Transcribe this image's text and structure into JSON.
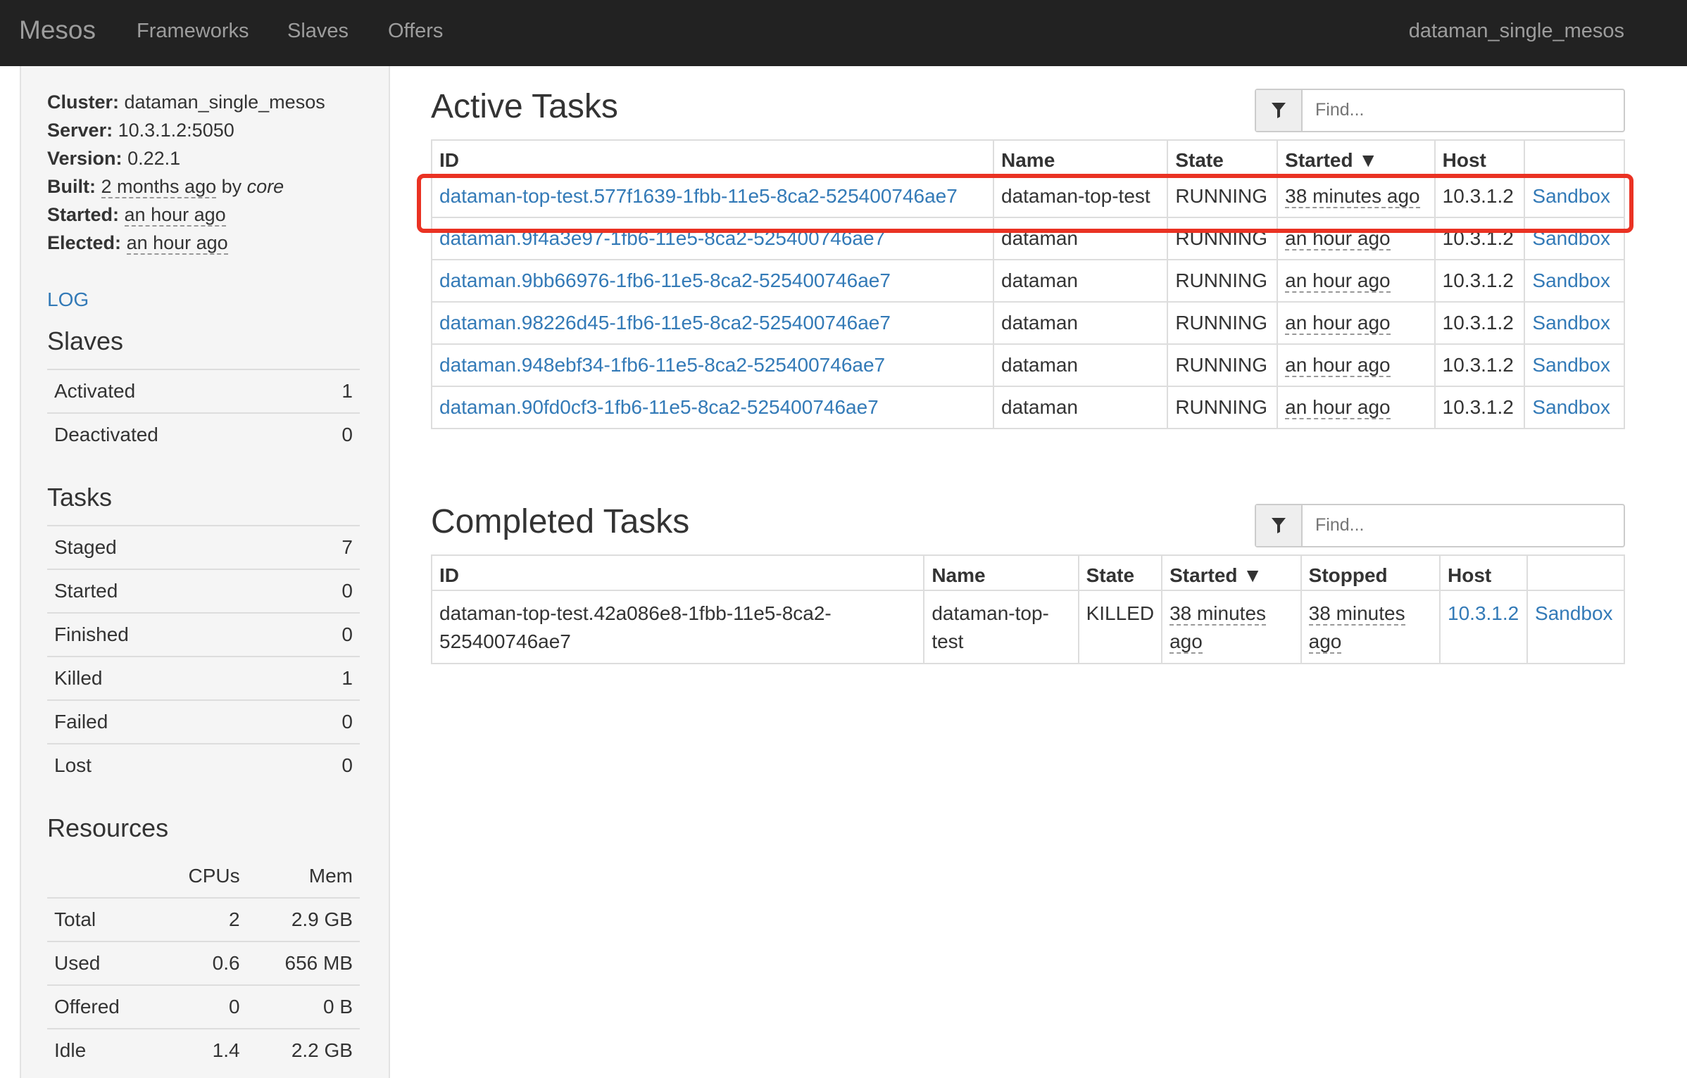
{
  "navbar": {
    "brand": "Mesos",
    "items": [
      "Frameworks",
      "Slaves",
      "Offers"
    ],
    "cluster": "dataman_single_mesos"
  },
  "sidebar": {
    "cluster_label": "Cluster:",
    "cluster_value": "dataman_single_mesos",
    "server_label": "Server:",
    "server_value": "10.3.1.2:5050",
    "version_label": "Version:",
    "version_value": "0.22.1",
    "built_label": "Built:",
    "built_time": "2 months ago",
    "built_by": "by",
    "built_user": "core",
    "started_label": "Started:",
    "started_value": "an hour ago",
    "elected_label": "Elected:",
    "elected_value": "an hour ago",
    "log_link": "LOG",
    "slaves_heading": "Slaves",
    "slaves": [
      {
        "label": "Activated",
        "value": "1"
      },
      {
        "label": "Deactivated",
        "value": "0"
      }
    ],
    "tasks_heading": "Tasks",
    "tasks": [
      {
        "label": "Staged",
        "value": "7"
      },
      {
        "label": "Started",
        "value": "0"
      },
      {
        "label": "Finished",
        "value": "0"
      },
      {
        "label": "Killed",
        "value": "1"
      },
      {
        "label": "Failed",
        "value": "0"
      },
      {
        "label": "Lost",
        "value": "0"
      }
    ],
    "resources_heading": "Resources",
    "resources_cols": [
      "CPUs",
      "Mem"
    ],
    "resources": [
      {
        "label": "Total",
        "cpus": "2",
        "mem": "2.9 GB"
      },
      {
        "label": "Used",
        "cpus": "0.6",
        "mem": "656 MB"
      },
      {
        "label": "Offered",
        "cpus": "0",
        "mem": "0 B"
      },
      {
        "label": "Idle",
        "cpus": "1.4",
        "mem": "2.2 GB"
      }
    ]
  },
  "active": {
    "title": "Active Tasks",
    "filter_placeholder": "Find...",
    "headers": {
      "id": "ID",
      "name": "Name",
      "state": "State",
      "started": "Started ▼",
      "host": "Host"
    },
    "rows": [
      {
        "id": "dataman-top-test.577f1639-1fbb-11e5-8ca2-525400746ae7",
        "name": "dataman-top-test",
        "state": "RUNNING",
        "started": "38 minutes ago",
        "host": "10.3.1.2",
        "sandbox": "Sandbox"
      },
      {
        "id": "dataman.9f4a3e97-1fb6-11e5-8ca2-525400746ae7",
        "name": "dataman",
        "state": "RUNNING",
        "started": "an hour ago",
        "host": "10.3.1.2",
        "sandbox": "Sandbox"
      },
      {
        "id": "dataman.9bb66976-1fb6-11e5-8ca2-525400746ae7",
        "name": "dataman",
        "state": "RUNNING",
        "started": "an hour ago",
        "host": "10.3.1.2",
        "sandbox": "Sandbox"
      },
      {
        "id": "dataman.98226d45-1fb6-11e5-8ca2-525400746ae7",
        "name": "dataman",
        "state": "RUNNING",
        "started": "an hour ago",
        "host": "10.3.1.2",
        "sandbox": "Sandbox"
      },
      {
        "id": "dataman.948ebf34-1fb6-11e5-8ca2-525400746ae7",
        "name": "dataman",
        "state": "RUNNING",
        "started": "an hour ago",
        "host": "10.3.1.2",
        "sandbox": "Sandbox"
      },
      {
        "id": "dataman.90fd0cf3-1fb6-11e5-8ca2-525400746ae7",
        "name": "dataman",
        "state": "RUNNING",
        "started": "an hour ago",
        "host": "10.3.1.2",
        "sandbox": "Sandbox"
      }
    ]
  },
  "completed": {
    "title": "Completed Tasks",
    "filter_placeholder": "Find...",
    "headers": {
      "id": "ID",
      "name": "Name",
      "state": "State",
      "started": "Started ▼",
      "stopped": "Stopped",
      "host": "Host"
    },
    "rows": [
      {
        "id_line1": "dataman-top-test.42a086e8-1fbb-11e5-8ca2-",
        "id_line2": "525400746ae7",
        "name_line1": "dataman-top-",
        "name_line2": "test",
        "state": "KILLED",
        "started_line1": "38 minutes",
        "started_line2": "ago",
        "stopped_line1": "38 minutes",
        "stopped_line2": "ago",
        "host": "10.3.1.2",
        "sandbox": "Sandbox"
      }
    ]
  }
}
